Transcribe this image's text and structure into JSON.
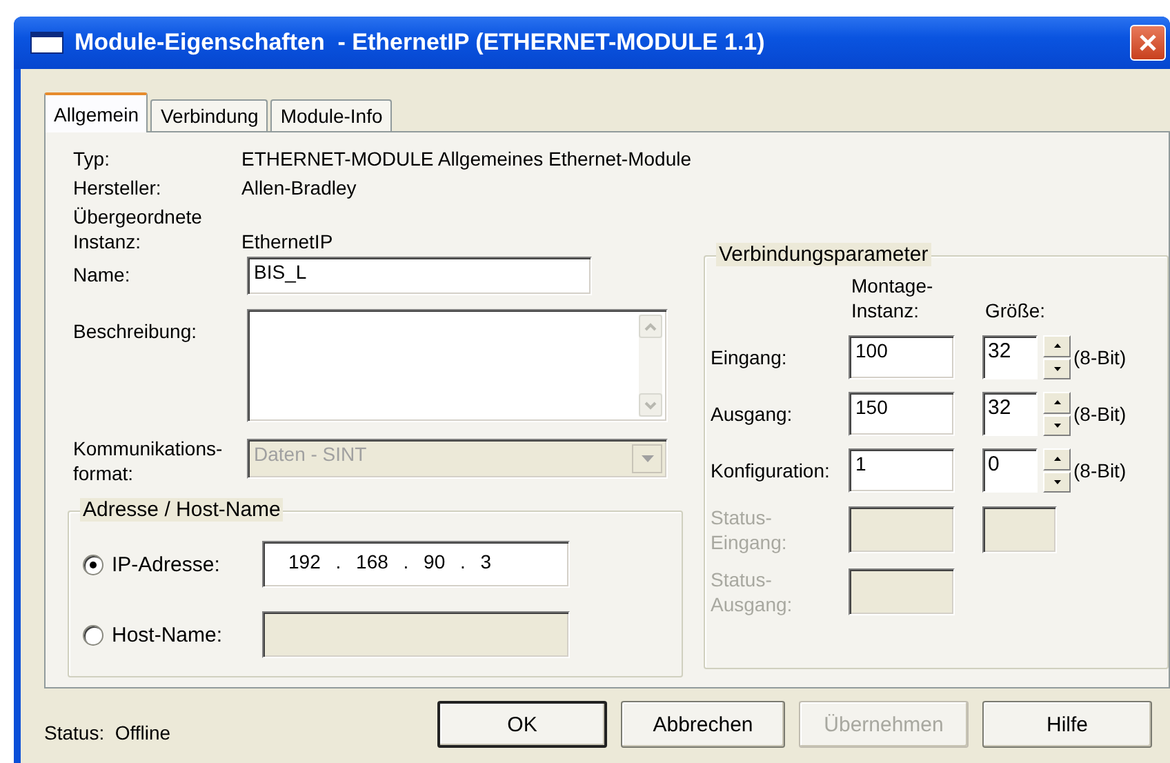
{
  "window": {
    "title": "Module-Eigenschaften  - EthernetIP (ETHERNET-MODULE 1.1)"
  },
  "tabs": [
    {
      "label": "Allgemein",
      "selected": true
    },
    {
      "label": "Verbindung",
      "selected": false
    },
    {
      "label": "Module-Info",
      "selected": false
    }
  ],
  "info": [
    {
      "label": "Typ:",
      "value": "ETHERNET-MODULE Allgemeines Ethernet-Module"
    },
    {
      "label": "Hersteller:",
      "value": "Allen-Bradley"
    },
    {
      "label": "Übergeordnete Instanz:",
      "value": "EthernetIP"
    }
  ],
  "name_field": {
    "label": "Name:",
    "value": "BIS_L"
  },
  "description": {
    "label": "Beschreibung:"
  },
  "comm_format": {
    "label": "Kommunikations-format:",
    "value": "Daten - SINT",
    "disabled": true
  },
  "address": {
    "title": "Adresse / Host-Name",
    "options": [
      {
        "label": "IP-Adresse:",
        "selected": true,
        "value": "192 . 168 . 90 . 3",
        "disabled": false
      },
      {
        "label": "Host-Name:",
        "selected": false,
        "disabled": true
      }
    ]
  },
  "connection": {
    "title": "Verbindungsparameter",
    "headers": [
      "Montage-Instanz:",
      "Größe:"
    ],
    "rows": [
      {
        "kind": "param",
        "label": "Eingang:",
        "instance": "100",
        "size": "32",
        "unit": "(8-Bit)",
        "disabled": false
      },
      {
        "kind": "param",
        "label": "Ausgang:",
        "instance": "150",
        "size": "32",
        "unit": "(8-Bit)",
        "disabled": false
      },
      {
        "kind": "param",
        "label": "Konfiguration:",
        "instance": "1",
        "size": "0",
        "unit": "(8-Bit)",
        "disabled": false
      },
      {
        "kind": "status",
        "label": "Status-Eingang:",
        "size_box": true,
        "disabled": true
      },
      {
        "kind": "status",
        "label": "Status-Ausgang:",
        "size_box": false,
        "disabled": true
      }
    ]
  },
  "status": {
    "label": "Status:",
    "value": "Offline"
  },
  "buttons": [
    {
      "label": "OK",
      "default": true,
      "disabled": false
    },
    {
      "label": "Abbrechen",
      "default": false,
      "disabled": false
    },
    {
      "label": "Übernehmen",
      "default": false,
      "disabled": true
    },
    {
      "label": "Hilfe",
      "default": false,
      "disabled": false
    }
  ]
}
